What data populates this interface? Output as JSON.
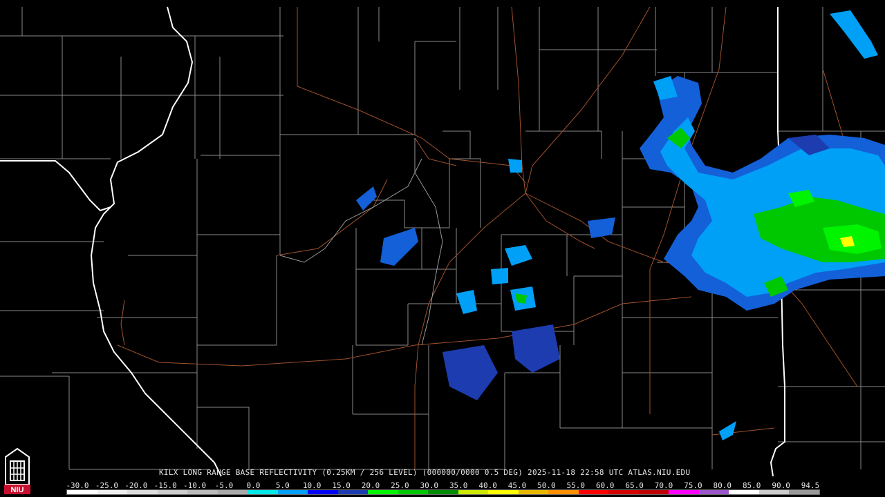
{
  "product": {
    "caption": "KILX LONG RANGE BASE REFLECTIVITY (0.25KM / 256 LEVEL) (000000/0000 0.5 DEG) 2025-11-18 22:58 UTC  ATLAS.NIU.EDU"
  },
  "logo": {
    "text": "NIU",
    "icon": "niu-logo-icon",
    "color": "#c8102e"
  },
  "map_colors": {
    "background": "#000000",
    "state_border": "#ffffff",
    "county_border": "#8a8a8a",
    "road": "#a0522d"
  },
  "legend": {
    "labels": [
      "-30.0",
      "-25.0",
      "-20.0",
      "-15.0",
      "-10.0",
      "-5.0",
      "0.0",
      "5.0",
      "10.0",
      "15.0",
      "20.0",
      "25.0",
      "30.0",
      "35.0",
      "40.0",
      "45.0",
      "50.0",
      "55.0",
      "60.0",
      "65.0",
      "70.0",
      "75.0",
      "80.0",
      "85.0",
      "90.0",
      "94.5"
    ],
    "colors": [
      "#ffffff",
      "#eeeeee",
      "#dddddd",
      "#cccccc",
      "#bbbbbb",
      "#aaaaaa",
      "#00e7e7",
      "#00a0f6",
      "#0000f6",
      "#1d3cb0",
      "#00f400",
      "#00c800",
      "#008c00",
      "#cce800",
      "#ffff00",
      "#e8b800",
      "#ff9000",
      "#ff0000",
      "#d40000",
      "#c00000",
      "#ff00ff",
      "#9955c9",
      "#ffffff",
      "#cccccc",
      "#999999"
    ]
  }
}
